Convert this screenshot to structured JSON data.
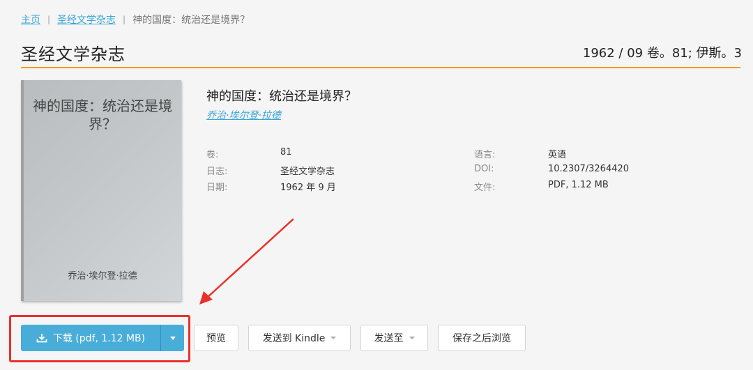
{
  "breadcrumb": {
    "home": "主页",
    "journal": "圣经文学杂志",
    "current": "神的国度：统治还是境界？"
  },
  "header": {
    "title": "圣经文学杂志",
    "meta": "1962 / 09 卷。81; 伊斯。3"
  },
  "cover": {
    "title": "神的国度：统治还是境界？",
    "author": "乔治·埃尔登·拉德"
  },
  "book": {
    "title": "神的国度：统治还是境界？",
    "author": "乔治·埃尔登·拉德"
  },
  "props": {
    "volume_label": "卷:",
    "volume_value": "81",
    "journal_label": "日志:",
    "journal_value": "圣经文学杂志",
    "date_label": "日期:",
    "date_value": "1962 年 9 月",
    "language_label": "语言:",
    "language_value": "英语",
    "doi_label": "DOI:",
    "doi_value": "10.2307/3264420",
    "file_label": "文件:",
    "file_value": "PDF, 1.12 MB"
  },
  "actions": {
    "download": "下载 (pdf, 1.12 MB)",
    "preview": "预览",
    "send_kindle": "发送到 Kindle",
    "send_to": "发送至",
    "save_later": "保存之后浏览"
  },
  "colors": {
    "accent_orange": "#f39c1f",
    "link_blue": "#3aa5d8",
    "download_blue": "#49add9",
    "annotation_red": "#e8312a"
  },
  "icons": {
    "download": "download-icon",
    "dropdown": "chevron-down-icon",
    "annotation": "red-arrow-icon"
  }
}
